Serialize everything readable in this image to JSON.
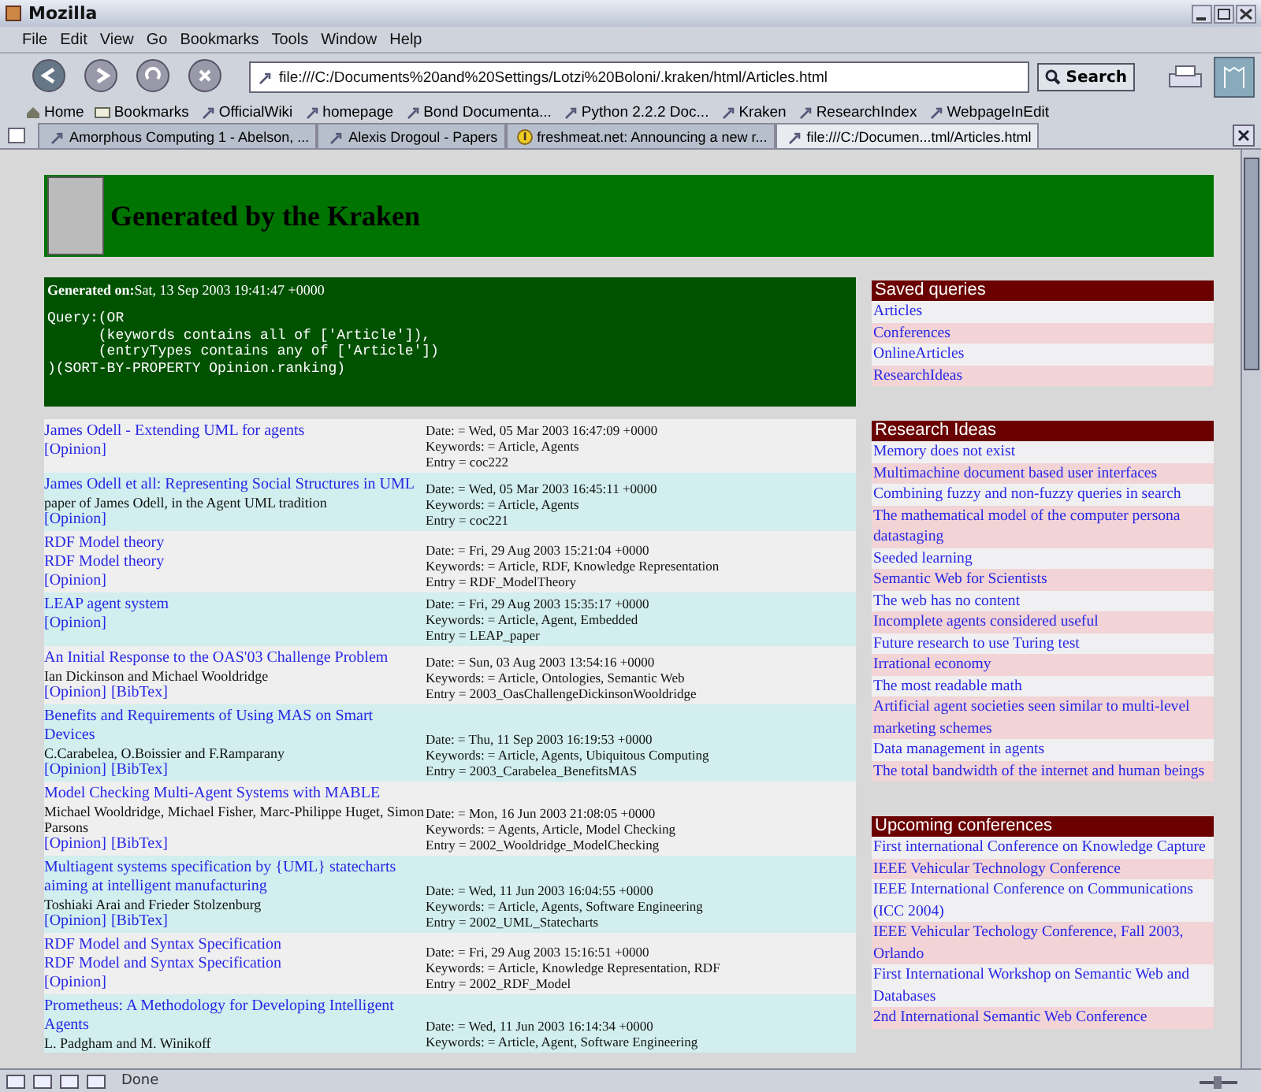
{
  "window": {
    "title": "Mozilla"
  },
  "menu": [
    "File",
    "Edit",
    "View",
    "Go",
    "Bookmarks",
    "Tools",
    "Window",
    "Help"
  ],
  "address": {
    "value": "file:///C:/Documents%20and%20Settings/Lotzi%20Boloni/.kraken/html/Articles.html"
  },
  "search_button": "Search",
  "bookmarks": [
    {
      "kind": "home",
      "label": "Home"
    },
    {
      "kind": "folder",
      "label": "Bookmarks"
    },
    {
      "kind": "link",
      "label": "OfficialWiki"
    },
    {
      "kind": "link",
      "label": "homepage"
    },
    {
      "kind": "link",
      "label": "Bond Documenta..."
    },
    {
      "kind": "link",
      "label": "Python 2.2.2 Doc..."
    },
    {
      "kind": "link",
      "label": "Kraken"
    },
    {
      "kind": "link",
      "label": "ResearchIndex"
    },
    {
      "kind": "link",
      "label": "WebpageInEdit"
    }
  ],
  "tabs": [
    {
      "label": "Amorphous Computing 1 - Abelson, ...",
      "kind": "link",
      "selected": false
    },
    {
      "label": "Alexis Drogoul - Papers",
      "kind": "link",
      "selected": false
    },
    {
      "label": "freshmeat.net: Announcing a new r...",
      "kind": "warning",
      "selected": false
    },
    {
      "label": "file:///C:/Documen...tml/Articles.html",
      "kind": "link",
      "selected": true
    }
  ],
  "page": {
    "title": "Generated by the Kraken",
    "generated_label": "Generated on:",
    "generated_value": "Sat, 13 Sep 2003 19:41:47 +0000",
    "query": "Query:(OR\n      (keywords contains all of ['Article']),\n      (entryTypes contains any of ['Article'])\n)(SORT-BY-PROPERTY Opinion.ranking)",
    "entries": [
      {
        "titles": [
          "James Odell - Extending UML for agents"
        ],
        "links": [
          "[Opinion]"
        ],
        "date": "Date: = Wed, 05 Mar 2003 16:47:09 +0000",
        "keywords": "Keywords: = Article, Agents",
        "entry": "Entry = coc222"
      },
      {
        "titles": [
          "James Odell et all: Representing Social Structures in UML"
        ],
        "authors": "paper of James Odell, in the Agent UML tradition",
        "links": [
          "[Opinion]"
        ],
        "date": "Date: = Wed, 05 Mar 2003 16:45:11 +0000",
        "keywords": "Keywords: = Article, Agents",
        "entry": "Entry = coc221"
      },
      {
        "titles": [
          "RDF Model theory",
          "RDF Model theory"
        ],
        "links": [
          "[Opinion]"
        ],
        "date": "Date: = Fri, 29 Aug 2003 15:21:04 +0000",
        "keywords": "Keywords: = Article, RDF, Knowledge Representation",
        "entry": "Entry = RDF_ModelTheory"
      },
      {
        "titles": [
          "LEAP agent system"
        ],
        "links": [
          "[Opinion]"
        ],
        "date": "Date: = Fri, 29 Aug 2003 15:35:17 +0000",
        "keywords": "Keywords: = Article, Agent, Embedded",
        "entry": "Entry = LEAP_paper"
      },
      {
        "titles": [
          "An Initial Response to the OAS'03 Challenge Problem"
        ],
        "authors": "Ian Dickinson and Michael Wooldridge",
        "links": [
          "[Opinion]",
          "[BibTex]"
        ],
        "date": "Date: = Sun, 03 Aug 2003 13:54:16 +0000",
        "keywords": "Keywords: = Article, Ontologies, Semantic Web",
        "entry": "Entry = 2003_OasChallengeDickinsonWooldridge"
      },
      {
        "titles": [
          "Benefits and Requirements of Using MAS on Smart Devices"
        ],
        "authors": "C.Carabelea, O.Boissier and F.Ramparany",
        "links": [
          "[Opinion]",
          "[BibTex]"
        ],
        "date": "Date: = Thu, 11 Sep 2003 16:19:53 +0000",
        "keywords": "Keywords: = Article, Agents, Ubiquitous Computing",
        "entry": "Entry = 2003_Carabelea_BenefitsMAS"
      },
      {
        "titles": [
          "Model Checking Multi-Agent Systems with MABLE"
        ],
        "authors": "Michael Wooldridge, Michael Fisher, Marc-Philippe Huget, Simon Parsons",
        "links": [
          "[Opinion]",
          "[BibTex]"
        ],
        "date": "Date: = Mon, 16 Jun 2003 21:08:05 +0000",
        "keywords": "Keywords: = Agents, Article, Model Checking",
        "entry": "Entry = 2002_Wooldridge_ModelChecking"
      },
      {
        "titles": [
          "Multiagent systems specification by {UML} statecharts aiming at intelligent manufacturing"
        ],
        "authors": "Toshiaki Arai and Frieder Stolzenburg",
        "links": [
          "[Opinion]",
          "[BibTex]"
        ],
        "date": "Date: = Wed, 11 Jun 2003 16:04:55 +0000",
        "keywords": "Keywords: = Article, Agents, Software Engineering",
        "entry": "Entry = 2002_UML_Statecharts"
      },
      {
        "titles": [
          "RDF Model and Syntax Specification",
          "RDF Model and Syntax Specification"
        ],
        "links": [
          "[Opinion]"
        ],
        "date": "Date: = Fri, 29 Aug 2003 15:16:51 +0000",
        "keywords": "Keywords: = Article, Knowledge Representation, RDF",
        "entry": "Entry = 2002_RDF_Model"
      },
      {
        "titles": [
          "Prometheus: A Methodology for Developing Intelligent Agents"
        ],
        "authors": "L. Padgham and M. Winikoff",
        "date": "Date: = Wed, 11 Jun 2003 16:14:34 +0000",
        "keywords": "Keywords: = Article, Agent, Software Engineering"
      }
    ],
    "sidebar": [
      {
        "title": "Saved queries",
        "items": [
          "Articles",
          "Conferences",
          "OnlineArticles",
          "ResearchIdeas"
        ]
      },
      {
        "title": "Research Ideas",
        "items": [
          "Memory does not exist",
          "Multimachine document based user interfaces",
          "Combining fuzzy and non-fuzzy queries in search",
          "The mathematical model of the computer persona datastaging",
          "Seeded learning",
          "Semantic Web for Scientists",
          "The web has no content",
          "Incomplete agents considered useful",
          "Future research to use Turing test",
          "Irrational economy",
          "The most readable math",
          "Artificial agent societies seen similar to multi-level marketing schemes",
          "Data management in agents",
          "The total bandwidth of the internet and human beings"
        ]
      },
      {
        "title": "Upcoming conferences",
        "items": [
          "First international Conference on Knowledge Capture",
          "IEEE Vehicular Technology Conference",
          "IEEE International Conference on Communications (ICC 2004)",
          "IEEE Vehicular Techology Conference, Fall 2003, Orlando",
          "First International Workshop on Semantic Web and Databases",
          "2nd International Semantic Web Conference"
        ]
      }
    ]
  },
  "status_bar": {
    "text": "Done"
  }
}
